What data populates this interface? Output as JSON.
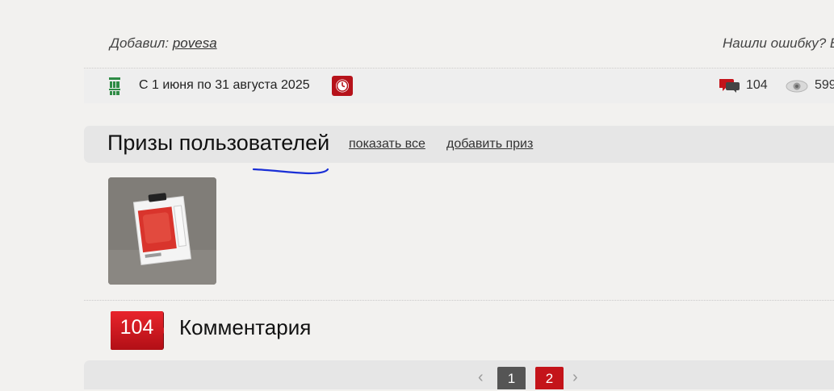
{
  "author": {
    "label": "Добавил:",
    "name": "povesa"
  },
  "report_error": "Нашли ошибку? В",
  "info": {
    "brand_logo": "fresh-bar-logo",
    "period": "С 1 июня по 31 августа 2025",
    "comments_count": "104",
    "views_count": "599"
  },
  "prizes": {
    "title": "Призы пользователей",
    "show_all": "показать все",
    "add_prize": "добавить приз"
  },
  "comments": {
    "count": "104",
    "title": "Комментария"
  },
  "pagination": {
    "pages": [
      "1",
      "2"
    ],
    "current": "2"
  },
  "colors": {
    "accent_red": "#c4141a",
    "background": "#f2f1ef",
    "bar": "#e6e6e6"
  }
}
